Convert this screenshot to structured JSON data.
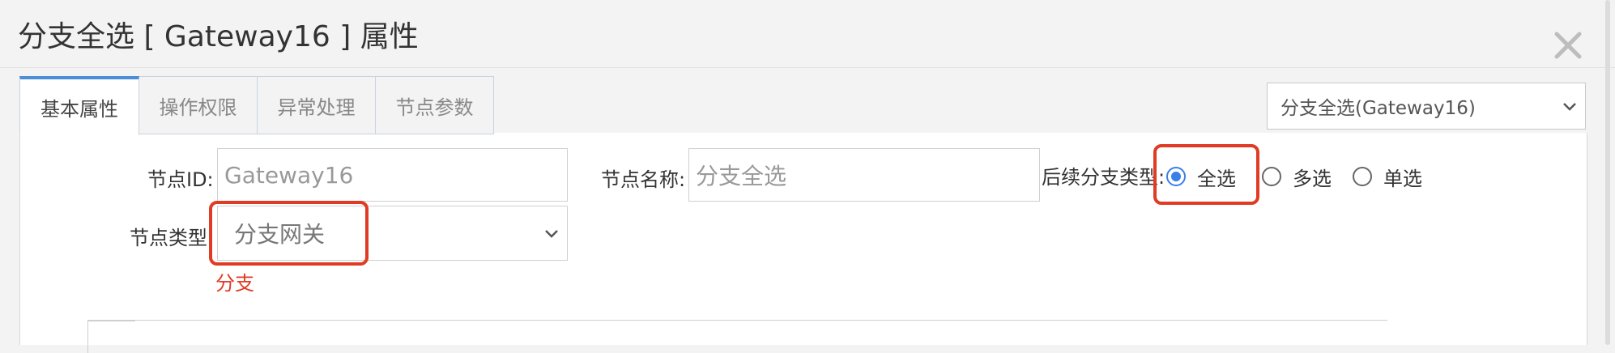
{
  "dialog": {
    "title": "分支全选 [ Gateway16 ] 属性",
    "close_symbol": "×"
  },
  "tabs": [
    {
      "label": "基本属性",
      "active": true
    },
    {
      "label": "操作权限",
      "active": false
    },
    {
      "label": "异常处理",
      "active": false
    },
    {
      "label": "节点参数",
      "active": false
    }
  ],
  "node_selector": {
    "value": "分支全选(Gateway16)",
    "icon": "chevron-down-icon"
  },
  "form": {
    "node_id": {
      "label": "节点ID:",
      "value": "Gateway16"
    },
    "node_name": {
      "label": "节点名称:",
      "value": "分支全选"
    },
    "branch_type": {
      "label": "后续分支类型:",
      "options": [
        {
          "label": "全选",
          "checked": true
        },
        {
          "label": "多选",
          "checked": false
        },
        {
          "label": "单选",
          "checked": false
        }
      ]
    },
    "node_type": {
      "label": "节点类型",
      "value": "分支网关",
      "icon": "chevron-down-icon"
    }
  },
  "annotation": {
    "text": "分支",
    "color": "#e03b24"
  },
  "colors": {
    "accent": "#4b8dd6",
    "radio": "#3a7ee8",
    "highlight": "#e03b24"
  }
}
